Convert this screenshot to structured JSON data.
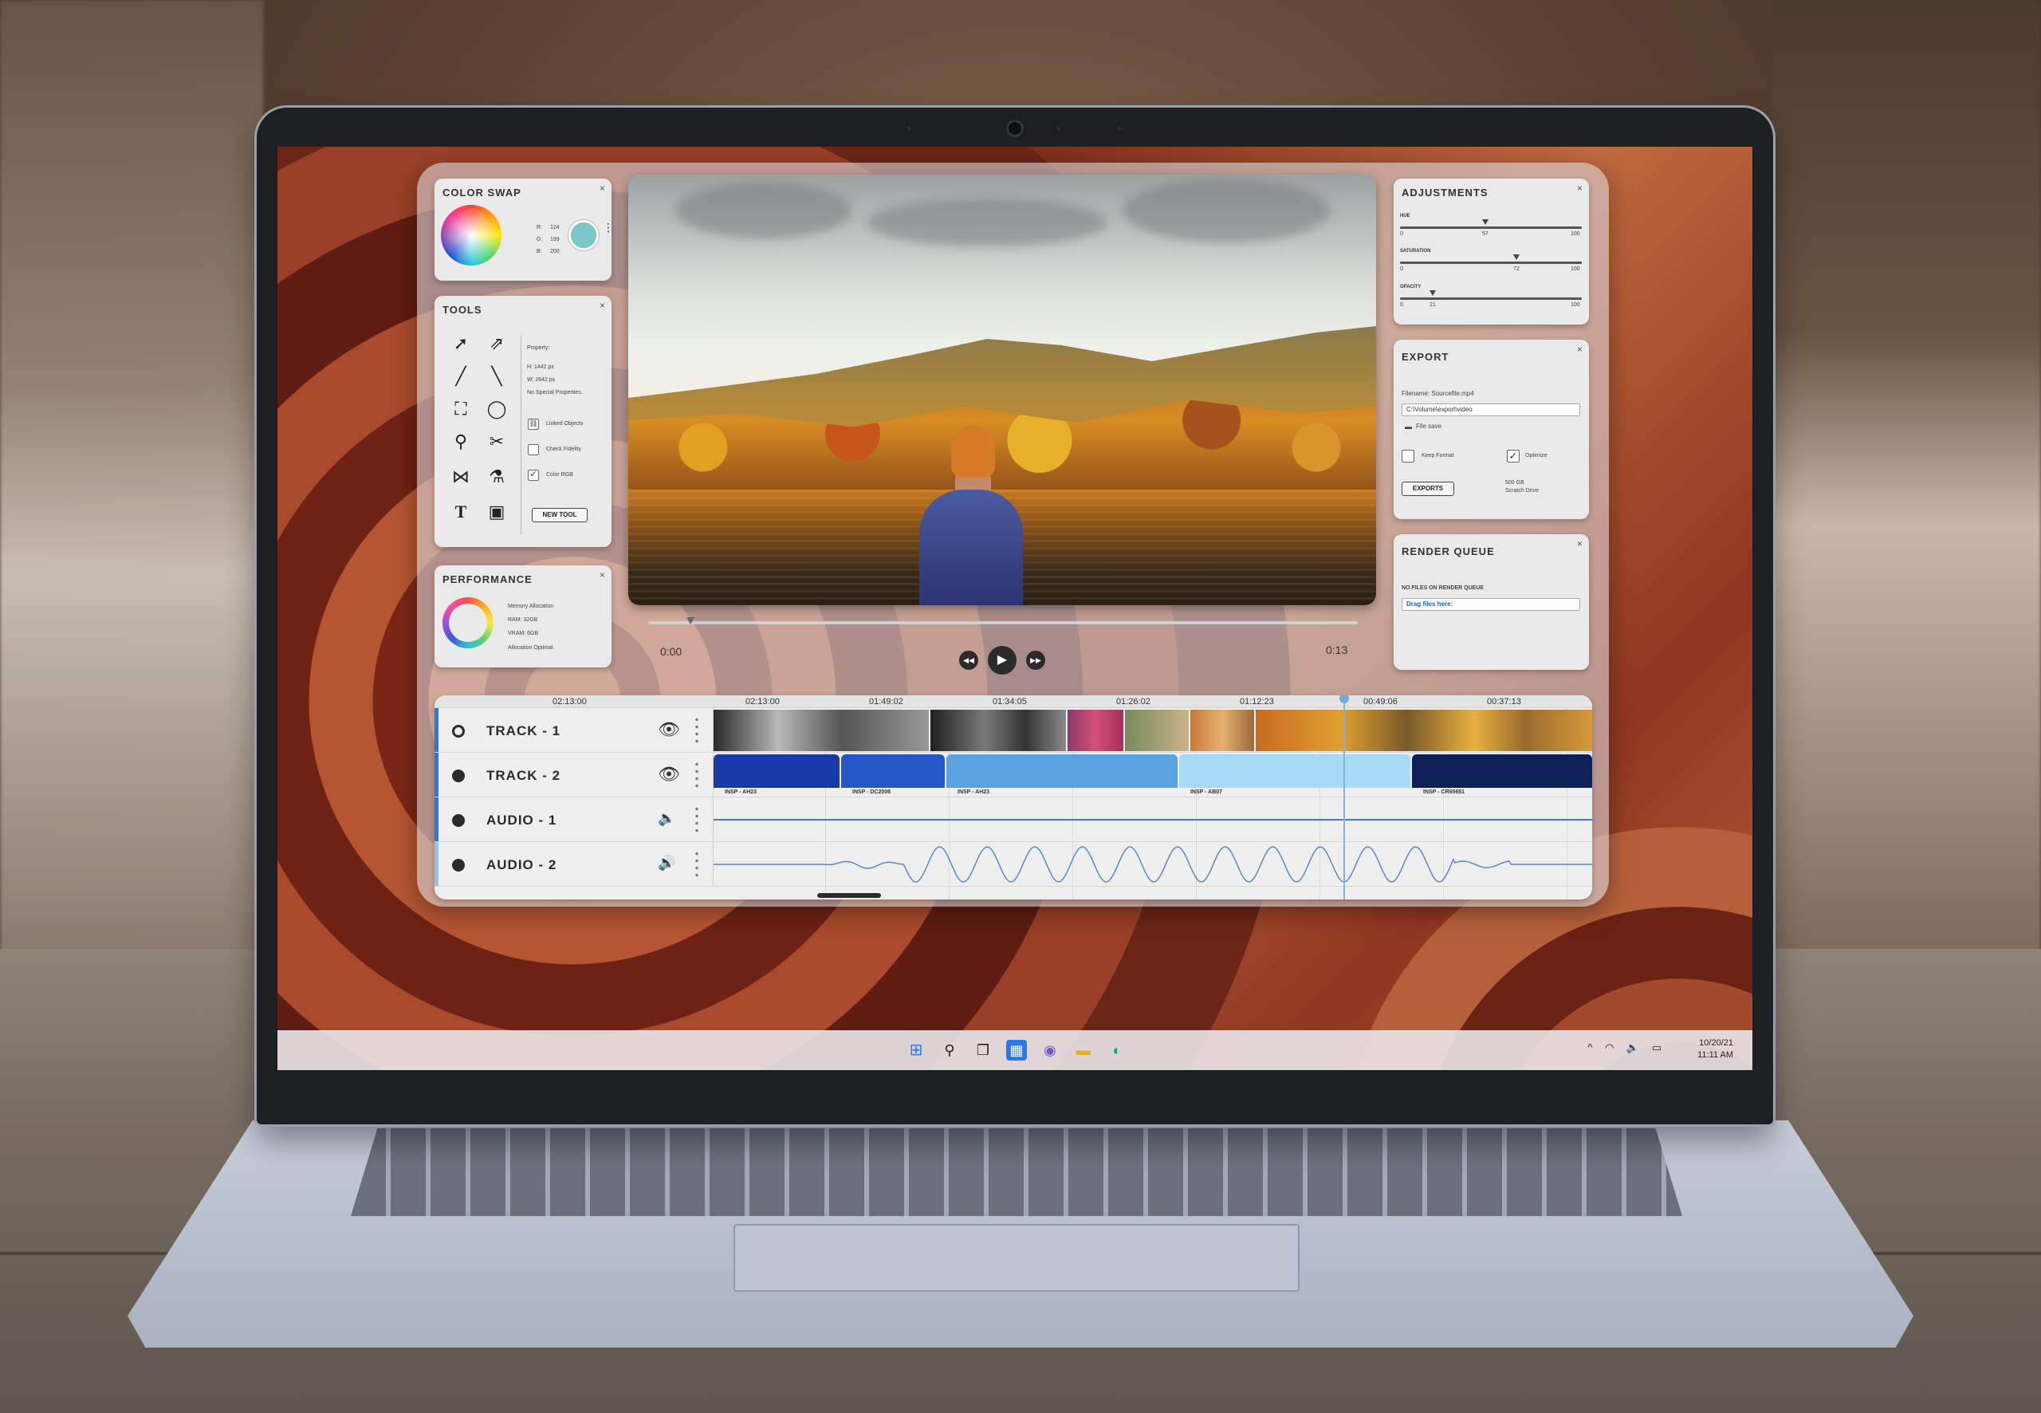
{
  "panels": {
    "color_swap": {
      "title": "COLOR SWAP",
      "r_label": "R:",
      "r_value": "124",
      "g_label": "G:",
      "g_value": "199",
      "b_label": "B:",
      "b_value": "200",
      "swatch_color": "#7cc5c8"
    },
    "tools": {
      "title": "TOOLS",
      "property_label": "Property:",
      "height": "H: 1442 px",
      "width": "W: 2642 px",
      "special": "No Special Properties.",
      "linked_objects": "Linked Objects",
      "check_fidelity": "Check Fidelity",
      "color_rgb": "Color RGB",
      "new_tool": "NEW TOOL",
      "icons": [
        "arrow-icon",
        "arrow-outline-icon",
        "brush-icon",
        "pen-icon",
        "crop-icon",
        "lasso-icon",
        "magnifier-icon",
        "scissors-icon",
        "flip-icon",
        "eyedropper-icon",
        "text-icon",
        "gradient-icon"
      ]
    },
    "performance": {
      "title": "PERFORMANCE",
      "memory": "Memory Allocation",
      "ram": "RAM: 32GB",
      "vram": "VRAM: 6GB",
      "status": "Allocation Optimal."
    },
    "adjustments": {
      "title": "ADJUSTMENTS",
      "sliders": [
        {
          "label": "HUE",
          "min": "0",
          "value": "57",
          "max": "100"
        },
        {
          "label": "SATURATION",
          "min": "0",
          "value": "72",
          "max": "100"
        },
        {
          "label": "OPACITY",
          "min": "0",
          "value": "21",
          "max": "100"
        }
      ]
    },
    "export": {
      "title": "EXPORT",
      "filename": "Filename: Sourcefile.mp4",
      "path": "C:\\Volume\\export\\video",
      "file_save": "File save",
      "keep_format": "Keep Format",
      "optimize": "Optimize",
      "button": "EXPORTS",
      "scratch_size": "500 GB",
      "scratch_label": "Scratch Drive"
    },
    "render_queue": {
      "title": "RENDER QUEUE",
      "empty": "NO FILES ON RENDER QUEUE",
      "drop": "Drag files here:"
    }
  },
  "player": {
    "time_start": "0:00",
    "time_end": "0:13",
    "progress": 0.06
  },
  "timeline": {
    "header_time": "02:13:00",
    "ruler": [
      "02:13:00",
      "01:49:02",
      "01:34:05",
      "01:26:02",
      "01:12:23",
      "00:49:06",
      "00:37:13"
    ],
    "tracks": [
      {
        "name": "TRACK - 1",
        "icon": "eye-icon",
        "accent": "#2b78d8"
      },
      {
        "name": "TRACK - 2",
        "icon": "eye-icon",
        "accent": "#2b78d8"
      },
      {
        "name": "AUDIO - 1",
        "icon": "speaker-icon",
        "accent": "#2b78d8"
      },
      {
        "name": "AUDIO - 2",
        "icon": "speaker-loud-icon",
        "accent": "#8ec4f0"
      }
    ],
    "track2_clips": [
      "INSP - AH23",
      "INSP - DC2008",
      "INSP - AH23",
      "INSP - AB07",
      "INSP - CR65651"
    ]
  },
  "taskbar": {
    "date": "10/20/21",
    "time": "11:11 AM",
    "apps": [
      "windows-start-icon",
      "search-icon",
      "task-view-icon",
      "widgets-icon",
      "teams-chat-icon",
      "file-explorer-icon",
      "edge-browser-icon"
    ]
  }
}
